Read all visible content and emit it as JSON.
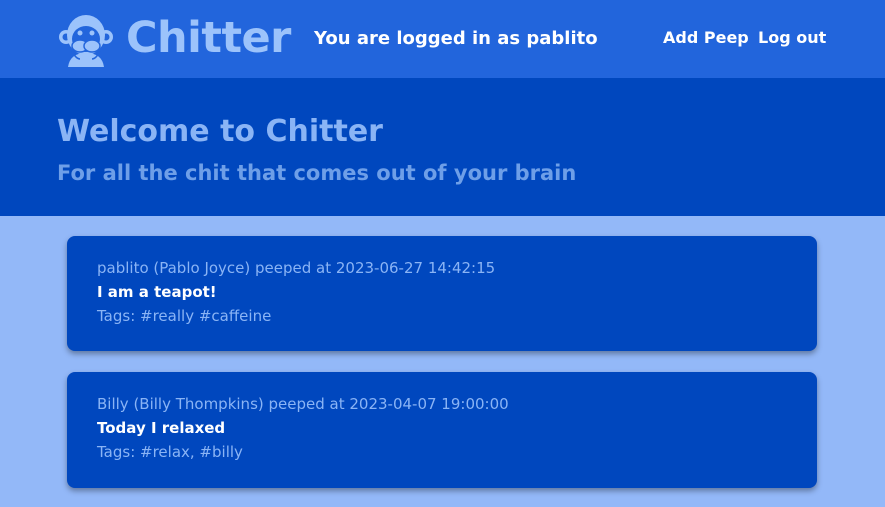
{
  "header": {
    "brand": "Chitter",
    "logged_in_text": "You are logged in as pablito",
    "nav": {
      "add_peep": "Add Peep",
      "log_out": "Log out"
    },
    "logo_icon": "see-no-evil-monkey-icon"
  },
  "hero": {
    "title": "Welcome to Chitter",
    "subtitle": "For all the chit that comes out of your brain"
  },
  "peeps": [
    {
      "meta": "pablito (Pablo Joyce) peeped at 2023-06-27 14:42:15",
      "body": "I am a teapot!",
      "tags": "Tags: #really #caffeine"
    },
    {
      "meta": "Billy (Billy Thompkins) peeped at 2023-04-07 19:00:00",
      "body": "Today I relaxed",
      "tags": "Tags: #relax, #billy"
    }
  ],
  "colors": {
    "topbar": "#2265dc",
    "hero": "#0047be",
    "page_background": "#93b8f8",
    "card": "#0047be",
    "brand_text": "#9cc3fb"
  }
}
